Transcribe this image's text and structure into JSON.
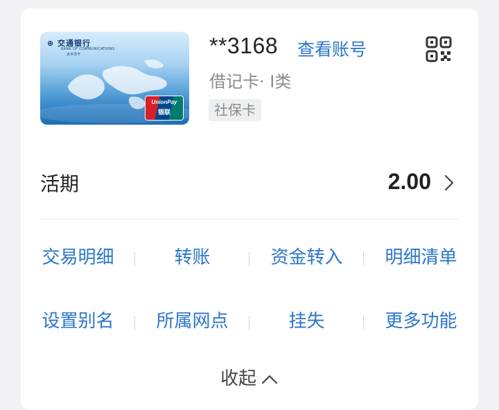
{
  "card": {
    "bank_name": "交通银行",
    "bank_name_en": "BANK OF COMMUNICATIONS",
    "card_sub": "太平洋卡",
    "unionpay_en": "UnionPay",
    "unionpay_cn": "银联",
    "masked_number": "**3168",
    "view_account_label": "查看账号",
    "card_type": "借记卡· Ⅰ类",
    "tag": "社保卡",
    "qr_icon": "qr-code-icon"
  },
  "balance": {
    "label": "活期",
    "amount": "2.00",
    "chevron_icon": "chevron-right-icon"
  },
  "actions": {
    "row1": [
      "交易明细",
      "转账",
      "资金转入",
      "明细清单"
    ],
    "row2": [
      "设置别名",
      "所属网点",
      "挂失",
      "更多功能"
    ]
  },
  "collapse": {
    "label": "收起",
    "icon": "chevron-up-icon"
  },
  "colors": {
    "accent": "#2b76c9",
    "text_primary": "#222222",
    "text_secondary": "#8a8a8f",
    "page_bg": "#f2f2f4",
    "card_bg": "#ffffff"
  }
}
